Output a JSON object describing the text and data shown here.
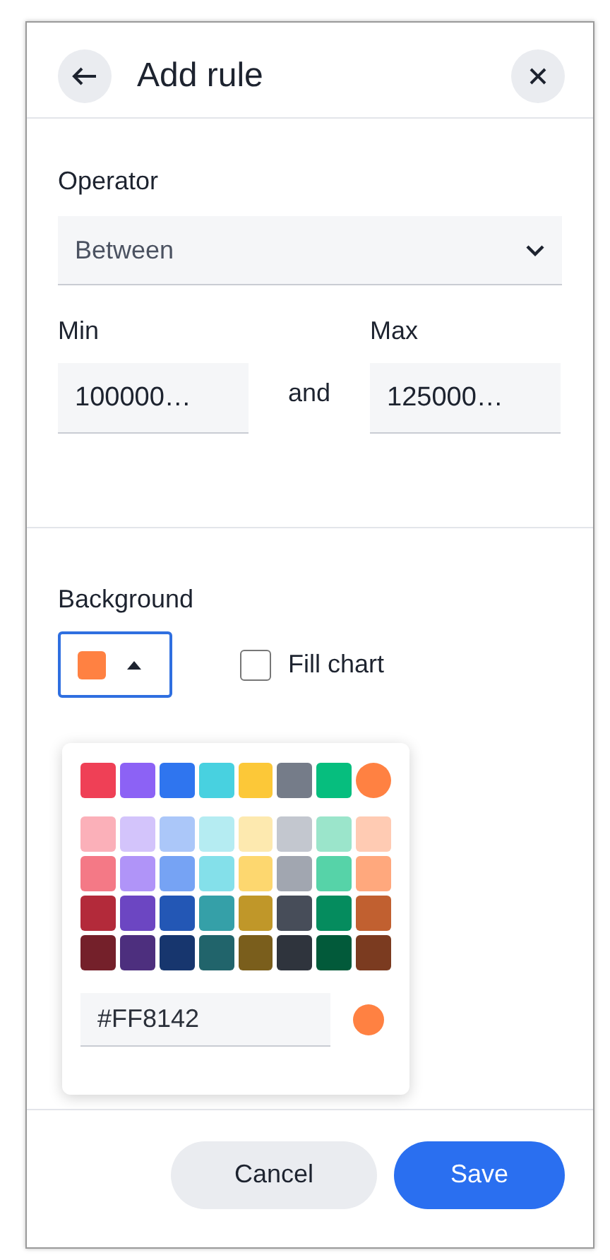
{
  "header": {
    "title": "Add rule"
  },
  "operator": {
    "label": "Operator",
    "value": "Between"
  },
  "range": {
    "min_label": "Min",
    "min_value": "100000…",
    "joiner": "and",
    "max_label": "Max",
    "max_value": "125000…"
  },
  "background": {
    "label": "Background",
    "expanded": true
  },
  "fill_chart": {
    "label": "Fill chart",
    "checked": false
  },
  "palette": {
    "rows": [
      [
        {
          "color": "#ef4056",
          "selected": false
        },
        {
          "color": "#8c62f5",
          "selected": false
        },
        {
          "color": "#2f75ef",
          "selected": false
        },
        {
          "color": "#48d1e0",
          "selected": false
        },
        {
          "color": "#fcc838",
          "selected": false
        },
        {
          "color": "#757c89",
          "selected": false
        },
        {
          "color": "#06be7e",
          "selected": false
        },
        {
          "color": "#ff8142",
          "selected": true
        }
      ],
      [
        {
          "color": "#fbb0b9",
          "selected": false
        },
        {
          "color": "#d3c4fb",
          "selected": false
        },
        {
          "color": "#abc7f9",
          "selected": false
        },
        {
          "color": "#b5ecf2",
          "selected": false
        },
        {
          "color": "#fde9af",
          "selected": false
        },
        {
          "color": "#c3c7cf",
          "selected": false
        },
        {
          "color": "#9be5cb",
          "selected": false
        },
        {
          "color": "#ffcbb3",
          "selected": false
        }
      ],
      [
        {
          "color": "#f47986",
          "selected": false
        },
        {
          "color": "#b094f8",
          "selected": false
        },
        {
          "color": "#76a3f4",
          "selected": false
        },
        {
          "color": "#84e0ea",
          "selected": false
        },
        {
          "color": "#fdd76f",
          "selected": false
        },
        {
          "color": "#a1a6b0",
          "selected": false
        },
        {
          "color": "#56d3a8",
          "selected": false
        },
        {
          "color": "#ffa87d",
          "selected": false
        }
      ],
      [
        {
          "color": "#b32a3a",
          "selected": false
        },
        {
          "color": "#6c46c2",
          "selected": false
        },
        {
          "color": "#2357b5",
          "selected": false
        },
        {
          "color": "#35a0a8",
          "selected": false
        },
        {
          "color": "#c09729",
          "selected": false
        },
        {
          "color": "#474d59",
          "selected": false
        },
        {
          "color": "#058c5e",
          "selected": false
        },
        {
          "color": "#c16030",
          "selected": false
        }
      ],
      [
        {
          "color": "#74202a",
          "selected": false
        },
        {
          "color": "#4d2f7e",
          "selected": false
        },
        {
          "color": "#17366e",
          "selected": false
        },
        {
          "color": "#21646b",
          "selected": false
        },
        {
          "color": "#7a5e1c",
          "selected": false
        },
        {
          "color": "#2f343d",
          "selected": false
        },
        {
          "color": "#025a3a",
          "selected": false
        },
        {
          "color": "#7b3b20",
          "selected": false
        }
      ]
    ],
    "hex_value": "#FF8142"
  },
  "buttons": [
    {
      "label": "Cancel",
      "kind": "secondary"
    },
    {
      "label": "Save",
      "kind": "primary"
    }
  ]
}
